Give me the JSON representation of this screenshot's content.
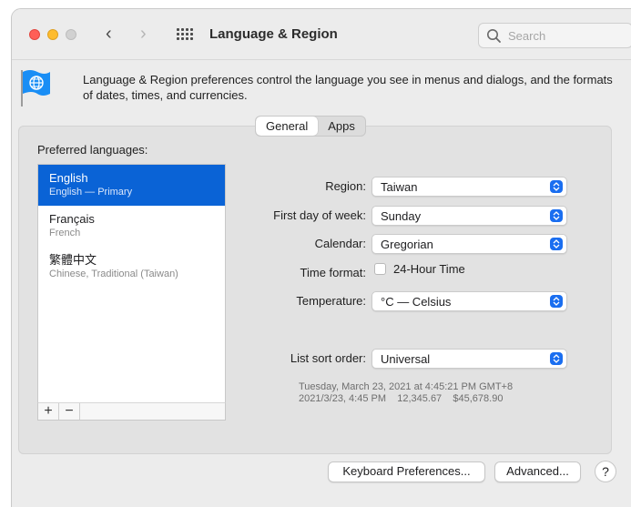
{
  "window": {
    "title": "Language & Region"
  },
  "search": {
    "placeholder": "Search"
  },
  "header": {
    "description": "Language & Region preferences control the language you see in menus and dialogs, and the formats of dates, times, and currencies."
  },
  "tabs": [
    {
      "label": "General",
      "active": true
    },
    {
      "label": "Apps",
      "active": false
    }
  ],
  "preferred": {
    "label": "Preferred languages:",
    "languages": [
      {
        "name": "English",
        "sub": "English — Primary",
        "selected": true
      },
      {
        "name": "Français",
        "sub": "French",
        "selected": false
      },
      {
        "name": "繁體中文",
        "sub": "Chinese, Traditional (Taiwan)",
        "selected": false
      }
    ],
    "add_label": "+",
    "remove_label": "−"
  },
  "settings": {
    "region": {
      "label": "Region:",
      "value": "Taiwan"
    },
    "first_day": {
      "label": "First day of week:",
      "value": "Sunday"
    },
    "calendar": {
      "label": "Calendar:",
      "value": "Gregorian"
    },
    "time_format": {
      "label": "Time format:",
      "checkbox_label": "24-Hour Time",
      "checked": false
    },
    "temperature": {
      "label": "Temperature:",
      "value": "°C — Celsius"
    },
    "sort_order": {
      "label": "List sort order:",
      "value": "Universal"
    }
  },
  "sample": {
    "line1": "Tuesday, March 23, 2021 at 4:45:21 PM GMT+8",
    "line2": "2021/3/23, 4:45 PM    12,345.67    $45,678.90"
  },
  "buttons": {
    "keyboard": "Keyboard Preferences...",
    "advanced": "Advanced...",
    "help": "?"
  },
  "colors": {
    "accent": "#0a63d6",
    "popup_arrow": "#1a6ef0",
    "close": "#ff5f57",
    "minimize": "#febc2e"
  },
  "icons": {
    "app": "globe-flag-icon",
    "search": "magnifier-icon",
    "grid": "grid-icon"
  }
}
